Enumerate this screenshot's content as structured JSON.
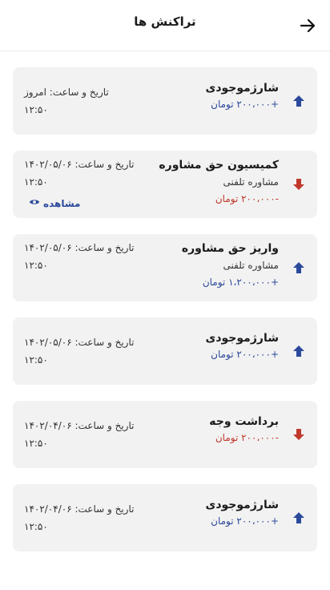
{
  "header": {
    "title": "تراکنش ها",
    "back_icon": "arrow-right-icon"
  },
  "transactions": [
    {
      "direction": "in",
      "title": "شارژموجودی",
      "subtitle": "",
      "amount": "+۲۰۰،۰۰۰ تومان",
      "date": "تاریخ و ساعت: امروز",
      "time": "۱۲:۵۰",
      "view": ""
    },
    {
      "direction": "out",
      "title": "کمیسیون حق مشاوره",
      "subtitle": "مشاوره تلفنی",
      "amount": "-۲۰۰،۰۰۰ تومان",
      "date": "تاریخ و ساعت: ۱۴۰۲/۰۵/۰۶",
      "time": "۱۲:۵۰",
      "view": "مشاهده"
    },
    {
      "direction": "in",
      "title": "واریز حق مشاوره",
      "subtitle": "مشاوره تلفنی",
      "amount": "+۱،۲۰۰،۰۰۰ تومان",
      "date": "تاریخ و ساعت: ۱۴۰۲/۰۵/۰۶",
      "time": "۱۲:۵۰",
      "view": ""
    },
    {
      "direction": "in",
      "title": "شارژموجودی",
      "subtitle": "",
      "amount": "+۲۰۰،۰۰۰ تومان",
      "date": "تاریخ و ساعت: ۱۴۰۲/۰۵/۰۶",
      "time": "۱۲:۵۰",
      "view": ""
    },
    {
      "direction": "out",
      "title": "برداشت وجه",
      "subtitle": "",
      "amount": "-۲۰۰،۰۰۰ تومان",
      "date": "تاریخ و ساعت: ۱۴۰۲/۰۴/۰۶",
      "time": "۱۲:۵۰",
      "view": ""
    },
    {
      "direction": "in",
      "title": "شارژموجودی",
      "subtitle": "",
      "amount": "+۲۰۰،۰۰۰ تومان",
      "date": "تاریخ و ساعت: ۱۴۰۲/۰۴/۰۶",
      "time": "۱۲:۵۰",
      "view": ""
    }
  ],
  "colors": {
    "in": "#2c4a9c",
    "out": "#c0392b"
  }
}
